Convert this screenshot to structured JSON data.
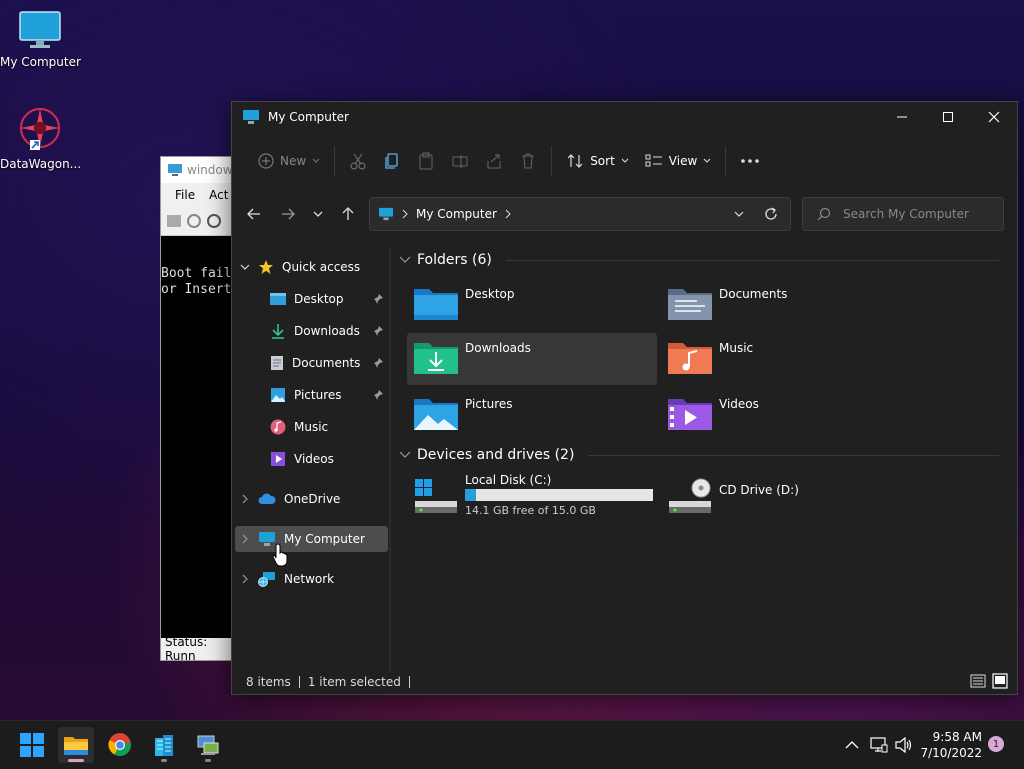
{
  "desktop": {
    "icons": [
      {
        "label": "My Computer"
      },
      {
        "label": "DataWagon..."
      }
    ]
  },
  "background_window": {
    "title": "windows",
    "menu": [
      "File",
      "Act"
    ],
    "terminal_lines": [
      "Boot fail",
      "or Insert"
    ],
    "status": "Status: Runn"
  },
  "explorer": {
    "title": "My Computer",
    "commands": {
      "new": "New",
      "sort": "Sort",
      "view": "View"
    },
    "address": {
      "path": "My Computer"
    },
    "search": {
      "placeholder": "Search My Computer"
    },
    "sidebar": {
      "quick_access": "Quick access",
      "items": [
        {
          "label": "Desktop",
          "pinned": true
        },
        {
          "label": "Downloads",
          "pinned": true
        },
        {
          "label": "Documents",
          "pinned": true
        },
        {
          "label": "Pictures",
          "pinned": true
        },
        {
          "label": "Music",
          "pinned": false
        },
        {
          "label": "Videos",
          "pinned": false
        }
      ],
      "onedrive": "OneDrive",
      "my_computer": "My Computer",
      "network": "Network"
    },
    "folders_header": "Folders (6)",
    "folders": [
      {
        "name": "Desktop"
      },
      {
        "name": "Documents"
      },
      {
        "name": "Downloads"
      },
      {
        "name": "Music"
      },
      {
        "name": "Pictures"
      },
      {
        "name": "Videos"
      }
    ],
    "drives_header": "Devices and drives (2)",
    "drives": [
      {
        "name": "Local Disk (C:)",
        "free_text": "14.1 GB free of 15.0 GB",
        "used_fraction": 0.06
      },
      {
        "name": "CD Drive (D:)"
      }
    ],
    "status": {
      "items": "8 items",
      "selected": "1 item selected"
    }
  },
  "taskbar": {
    "time": "9:58 AM",
    "date": "7/10/2022",
    "notification_count": "1"
  }
}
